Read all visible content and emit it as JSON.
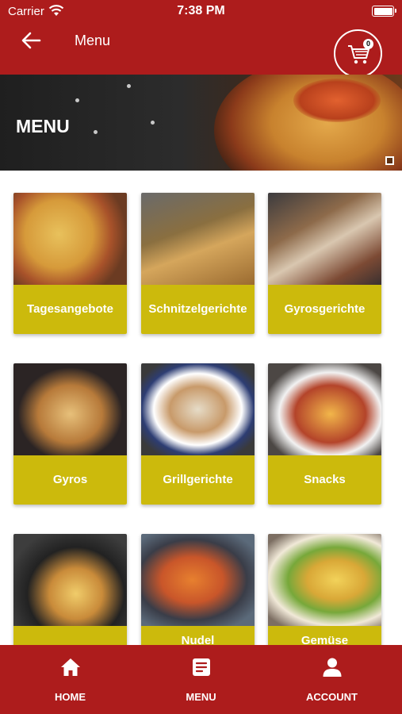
{
  "status": {
    "carrier": "Carrier",
    "time": "7:38 PM"
  },
  "navbar": {
    "title": "Menu",
    "cart_count": "0"
  },
  "hero": {
    "title": "MENU"
  },
  "categories": [
    {
      "label": "Tagesangebote"
    },
    {
      "label": "Schnitzelgerichte"
    },
    {
      "label": "Gyrosgerichte"
    },
    {
      "label": "Gyros"
    },
    {
      "label": "Grillgerichte"
    },
    {
      "label": "Snacks"
    },
    {
      "label": ""
    },
    {
      "label": "Nudel"
    },
    {
      "label": "Gemüse"
    }
  ],
  "tabbar": {
    "home": "HOME",
    "menu": "MENU",
    "account": "ACCOUNT"
  },
  "colors": {
    "primary": "#ad1c1c",
    "card_label": "#ccba0c"
  },
  "icons": [
    "wifi-icon",
    "battery-icon",
    "back-arrow-icon",
    "cart-icon",
    "home-icon",
    "menu-icon",
    "account-icon",
    "expand-icon"
  ]
}
